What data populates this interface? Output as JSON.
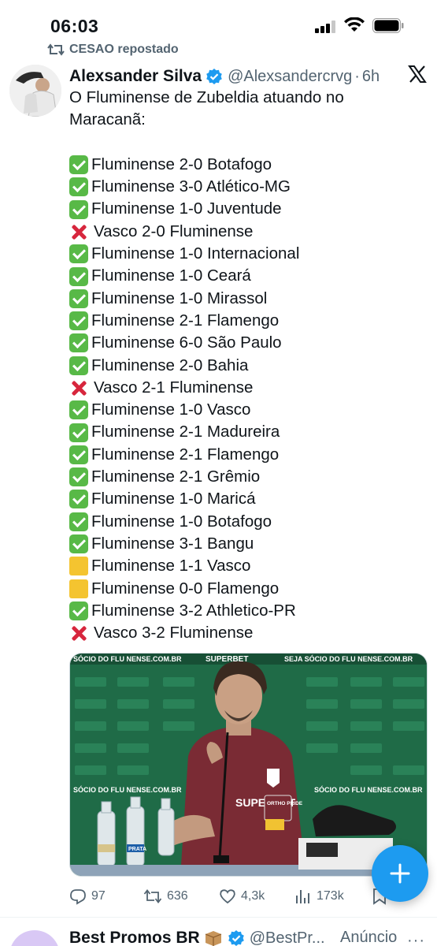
{
  "status_bar": {
    "time": "06:03"
  },
  "repost": {
    "text": "CESAO repostado"
  },
  "tweet": {
    "author_name": "Alexsander Silva",
    "handle": "@Alexsandercrvg",
    "time_sep": "·",
    "time": "6h",
    "intro_line1": "O Fluminense de Zubeldia atuando no",
    "intro_line2": "Maracanã:",
    "results": [
      {
        "icon": "check",
        "text": "Fluminense 2-0 Botafogo"
      },
      {
        "icon": "check",
        "text": "Fluminense 3-0 Atlético-MG"
      },
      {
        "icon": "check",
        "text": "Fluminense 1-0 Juventude"
      },
      {
        "icon": "cross",
        "text": "Vasco 2-0 Fluminense"
      },
      {
        "icon": "check",
        "text": "Fluminense 1-0 Internacional"
      },
      {
        "icon": "check",
        "text": "Fluminense 1-0 Ceará"
      },
      {
        "icon": "check",
        "text": "Fluminense 1-0 Mirassol"
      },
      {
        "icon": "check",
        "text": "Fluminense 2-1 Flamengo"
      },
      {
        "icon": "check",
        "text": "Fluminense 6-0 São Paulo"
      },
      {
        "icon": "check",
        "text": "Fluminense 2-0 Bahia"
      },
      {
        "icon": "cross",
        "text": "Vasco 2-1 Fluminense"
      },
      {
        "icon": "check",
        "text": "Fluminense 1-0 Vasco"
      },
      {
        "icon": "check",
        "text": "Fluminense 2-1 Madureira"
      },
      {
        "icon": "check",
        "text": "Fluminense 2-1 Flamengo"
      },
      {
        "icon": "check",
        "text": "Fluminense 2-1 Grêmio"
      },
      {
        "icon": "check",
        "text": "Fluminense 1-0 Maricá"
      },
      {
        "icon": "check",
        "text": "Fluminense 1-0 Botafogo"
      },
      {
        "icon": "check",
        "text": "Fluminense 3-1 Bangu"
      },
      {
        "icon": "draw",
        "text": "Fluminense 1-1 Vasco"
      },
      {
        "icon": "draw",
        "text": "Fluminense 0-0 Flamengo"
      },
      {
        "icon": "check",
        "text": "Fluminense 3-2 Athletico-PR"
      },
      {
        "icon": "cross",
        "text": "Vasco 3-2 Fluminense"
      }
    ],
    "media": {
      "backdrop_text": {
        "top_left": "SÓCIO DO FLU NENSE.COM.BR",
        "top_mid": "SUPERBET",
        "top_right": "SEJA SÓCIO DO FLU NENSE.COM.BR",
        "mid_left": "SÓCIO DO FLU NENSE.COM.BR",
        "mid_right": "SÓCIO DO FLU NENSE.COM.BR",
        "shirt_sponsor": "SUPERBET",
        "badge": "ORTHO PRIDE",
        "bottle_label": "PRATA"
      }
    },
    "stats": {
      "replies": "97",
      "reposts": "636",
      "likes": "4,3k",
      "views": "173k"
    }
  },
  "next_tweet": {
    "author_name": "Best Promos BR",
    "handle": "@BestPr...",
    "ad_label": "Anúncio",
    "more": "···"
  },
  "colors": {
    "accent": "#1d9bf0",
    "secondary_text": "#536471",
    "check_green": "#58b947",
    "cross_red": "#d7263d",
    "draw_yellow": "#f4c430",
    "backdrop_green": "#1f6b47"
  }
}
